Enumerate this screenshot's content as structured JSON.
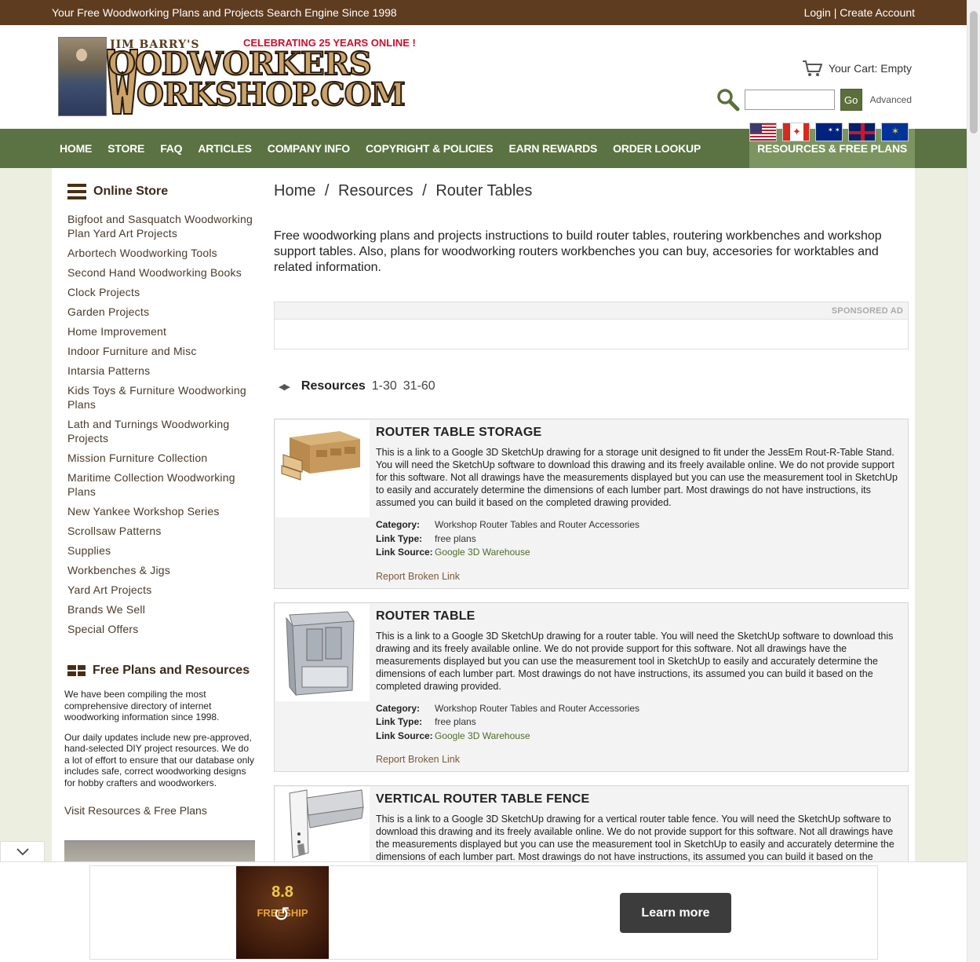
{
  "topbar": {
    "tagline": "Your Free Woodworking Plans and Projects Search Engine Since 1998",
    "login": "Login",
    "divider": "|",
    "create": "Create Account"
  },
  "header": {
    "logo_jim": "JIM BARRY'S",
    "logo_celebrate": "CELEBRATING 25 YEARS ONLINE !",
    "logo_line1": "OODWORKERS",
    "logo_line2": "ORKSHOP.COM",
    "cart_label": "Your Cart: Empty",
    "search_value": "",
    "go_label": "Go",
    "advanced_label": "Advanced",
    "flags": [
      "us-flag-icon",
      "canada-flag-icon",
      "australia-flag-icon",
      "uk-flag-icon",
      "eu-flag-icon"
    ]
  },
  "nav": {
    "items": [
      "HOME",
      "STORE",
      "FAQ",
      "ARTICLES",
      "COMPANY INFO",
      "COPYRIGHT & POLICIES",
      "EARN REWARDS",
      "ORDER LOOKUP"
    ],
    "active": "RESOURCES & FREE PLANS"
  },
  "sidebar": {
    "store_title": "Online Store",
    "store_items": [
      "Bigfoot and Sasquatch Woodworking Plan Yard Art Projects",
      "Arbortech Woodworking Tools",
      "Second Hand Woodworking Books",
      "Clock Projects",
      "Garden Projects",
      "Home Improvement",
      "Indoor Furniture and Misc",
      "Intarsia Patterns",
      "Kids Toys & Furniture Woodworking Plans",
      "Lath and Turnings Woodworking Projects",
      "Mission Furniture Collection",
      "Maritime Collection Woodworking Plans",
      "New Yankee Workshop Series",
      "Scrollsaw Patterns",
      "Supplies",
      "Workbenches & Jigs",
      "Yard Art Projects",
      "Brands We Sell",
      "Special Offers"
    ],
    "free_title": "Free Plans and Resources",
    "free_p1": "We have been compiling the most comprehensive directory of internet woodworking information since 1998.",
    "free_p2": "Our daily updates include new pre-approved, hand-selected DIY project resources. We do a lot of effort to ensure that our database only includes safe, correct woodworking designs for hobby crafters and woodworkers.",
    "visit": "Visit Resources & Free Plans"
  },
  "main": {
    "breadcrumb": [
      "Home",
      "Resources",
      "Router Tables"
    ],
    "breadcrumb_sep": "/",
    "intro": "Free woodworking plans and projects instructions to build router tables, routering workbenches and workshop support tables. Also, plans for woodworking routers workbenches you can buy, accesories for worktables and related information.",
    "ad_label": "SPONSORED AD",
    "pager_label": "Resources",
    "pages": [
      "1-30",
      "31-60"
    ],
    "cards": [
      {
        "title": "ROUTER TABLE STORAGE",
        "desc": "This is a link to a Google 3D SketchUp drawing for a storage unit designed to fit under the JessEm Rout-R-Table Stand. You will need the SketchUp software to download this drawing and its freely available online. We do not provide support for this software. Not all drawings have the measurements displayed but you can use the measurement tool in SketchUp to easily and accurately determine the dimensions of each lumber part. Most drawings do not have instructions, its assumed you can build it based on the completed drawing provided.",
        "category_k": "Category:",
        "category": "Workshop Router Tables and Router Accessories",
        "type_k": "Link Type:",
        "type": "free plans",
        "source_k": "Link Source:",
        "source": "Google 3D Warehouse",
        "report": "Report Broken Link"
      },
      {
        "title": "ROUTER TABLE",
        "desc": "This is a link to a Google 3D SketchUp drawing for a router table. You will need the SketchUp software to download this drawing and its freely available online. We do not provide support for this software. Not all drawings have the measurements displayed but you can use the measurement tool in SketchUp to easily and accurately determine the dimensions of each lumber part. Most drawings do not have instructions, its assumed you can build it based on the completed drawing provided.",
        "category_k": "Category:",
        "category": "Workshop Router Tables and Router Accessories",
        "type_k": "Link Type:",
        "type": "free plans",
        "source_k": "Link Source:",
        "source": "Google 3D Warehouse",
        "report": "Report Broken Link"
      },
      {
        "title": "VERTICAL ROUTER TABLE FENCE",
        "desc": "This is a link to a Google 3D SketchUp drawing for a vertical router table fence. You will need the SketchUp software to download this drawing and its freely available online. We do not provide support for this software. Not all drawings have the measurements displayed but you can use the measurement tool in SketchUp to easily and accurately determine the dimensions of each lumber part. Most drawings do not have instructions, its assumed you can build it based on the completed drawing provided."
      }
    ]
  },
  "bottom_ad": {
    "thumb_top": "8.8",
    "thumb_mid": "FREESHIP",
    "learn_more": "Learn more"
  }
}
